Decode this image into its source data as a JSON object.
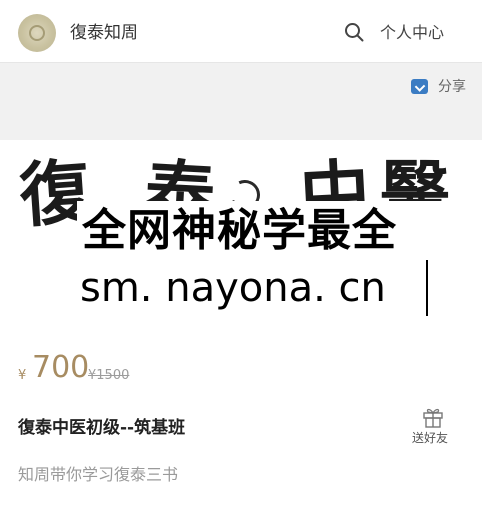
{
  "header": {
    "site_name": "復泰知周",
    "user_center_label": "个人中心",
    "icons": {
      "search": "search-icon",
      "avatar": "avatar-logo"
    }
  },
  "share": {
    "label": "分享",
    "icon": "share-icon",
    "icon_color": "#3b7cc3"
  },
  "banner": {
    "calligraphy": [
      "復",
      "泰",
      "中",
      "醫"
    ],
    "watermark_line1": "全网神秘学最全",
    "watermark_line2": "sm. nayona. cn"
  },
  "course": {
    "currency": "¥",
    "price": "700",
    "original_price": "¥1500",
    "title": "復泰中医初级--筑基班",
    "subtitle": "知周带你学习復泰三书",
    "gift_label": "送好友",
    "gift_icon": "gift-icon",
    "price_color": "#a78c62"
  }
}
